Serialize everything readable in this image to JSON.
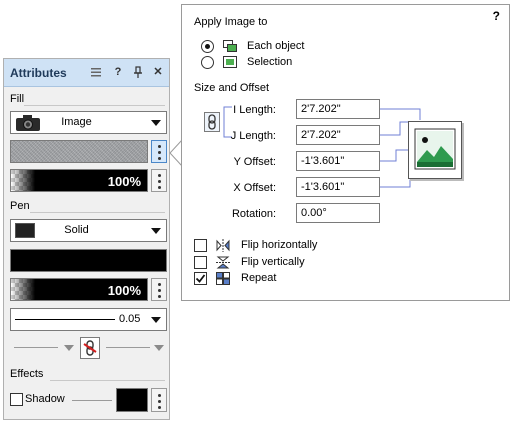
{
  "attributes_panel": {
    "title": "Attributes",
    "header_icons": [
      "menu-icon",
      "help-icon",
      "pin-icon",
      "close-icon"
    ],
    "help_glyph": "?",
    "close_glyph": "✕",
    "fill_section": "Fill",
    "fill_type": "Image",
    "fill_opacity": "100%",
    "pen_section": "Pen",
    "pen_type": "Solid",
    "pen_opacity": "100%",
    "pen_width": "0.05",
    "effects_section": "Effects",
    "shadow_label": "Shadow",
    "shadow_checked": false
  },
  "image_popup": {
    "help_glyph": "?",
    "apply_heading": "Apply Image to",
    "apply_options": [
      {
        "label": "Each object",
        "selected": true
      },
      {
        "label": "Selection",
        "selected": false
      }
    ],
    "size_heading": "Size and Offset",
    "fields": [
      {
        "label": "I Length:",
        "value": "2'7.202\""
      },
      {
        "label": "J Length:",
        "value": "2'7.202\""
      },
      {
        "label": "Y Offset:",
        "value": "-1'3.601\""
      },
      {
        "label": "X Offset:",
        "value": "-1'3.601\""
      },
      {
        "label": "Rotation:",
        "value": "0.00°"
      }
    ],
    "options": [
      {
        "label": "Flip horizontally",
        "checked": false
      },
      {
        "label": "Flip vertically",
        "checked": false
      },
      {
        "label": "Repeat",
        "checked": true
      }
    ]
  },
  "colors": {
    "header_bg": "#cfe2f5",
    "accent": "#4b87c8",
    "connector": "#6f7fd6"
  }
}
